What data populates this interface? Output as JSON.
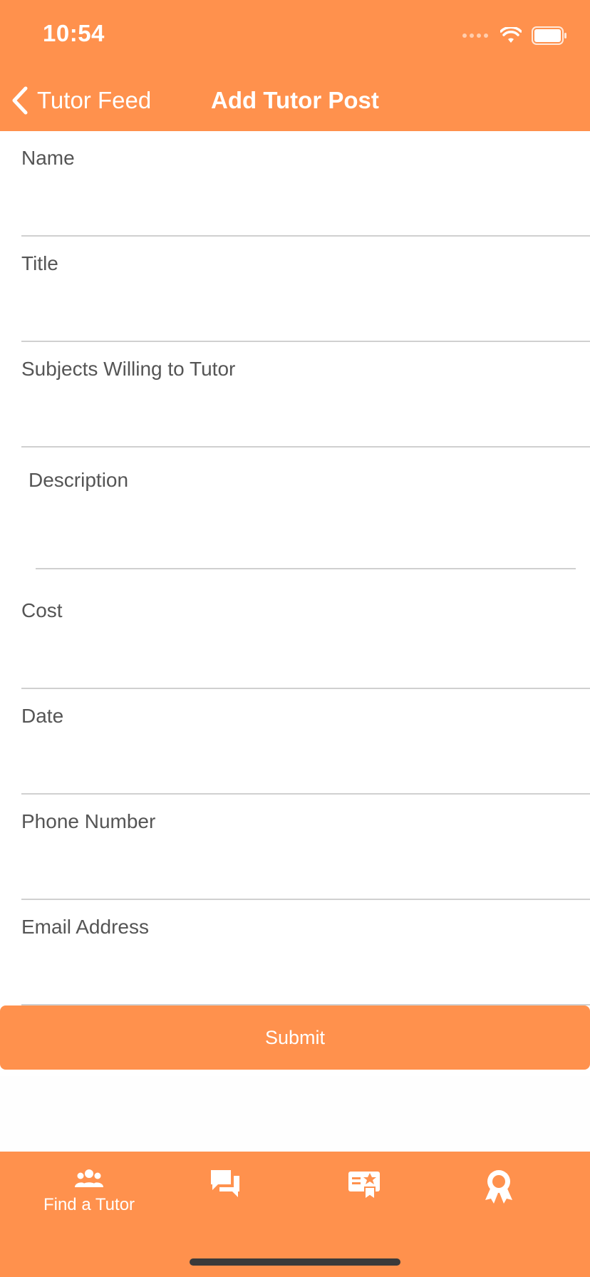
{
  "status_bar": {
    "time": "10:54"
  },
  "nav": {
    "back_label": "Tutor Feed",
    "title": "Add Tutor Post"
  },
  "form": {
    "fields": [
      {
        "label": "Name",
        "value": ""
      },
      {
        "label": "Title",
        "value": ""
      },
      {
        "label": "Subjects Willing to Tutor",
        "value": ""
      },
      {
        "label": "Description",
        "value": ""
      },
      {
        "label": "Cost",
        "value": ""
      },
      {
        "label": "Date",
        "value": ""
      },
      {
        "label": "Phone Number",
        "value": ""
      },
      {
        "label": "Email Address",
        "value": ""
      }
    ],
    "submit_label": "Submit"
  },
  "tabbar": {
    "tabs": [
      {
        "label": "Find a Tutor",
        "icon": "people-icon",
        "selected": true
      },
      {
        "label": "",
        "icon": "chat-bubbles-icon"
      },
      {
        "label": "",
        "icon": "certificate-icon"
      },
      {
        "label": "",
        "icon": "award-ribbon-icon"
      }
    ]
  },
  "colors": {
    "accent": "#FF914D",
    "label_text": "#555555",
    "divider": "#d0d0d0"
  }
}
